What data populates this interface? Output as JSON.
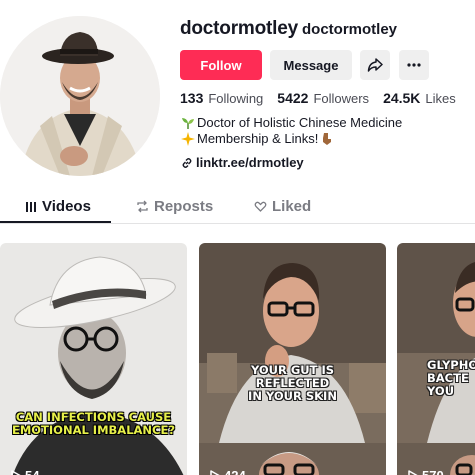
{
  "profile": {
    "username": "doctormotley",
    "nickname": "doctormotley"
  },
  "actions": {
    "follow_label": "Follow",
    "message_label": "Message",
    "share_icon": "share-arrow-icon",
    "more_icon": "more-dots-icon"
  },
  "stats": [
    {
      "value": "133",
      "label": "Following"
    },
    {
      "value": "5422",
      "label": "Followers"
    },
    {
      "value": "24.5K",
      "label": "Likes"
    }
  ],
  "bio": {
    "line1": "Doctor of Holistic Chinese Medicine",
    "line2": "Membership & Links!",
    "link": "linktr.ee/drmotley"
  },
  "tabs": [
    {
      "label": "Videos",
      "icon": "grid-icon",
      "active": true
    },
    {
      "label": "Reposts",
      "icon": "repost-icon",
      "active": false
    },
    {
      "label": "Liked",
      "icon": "heart-outline-icon",
      "active": false
    }
  ],
  "videos": [
    {
      "caption_lines": [
        "CAN INFECTIONS CAUSE",
        "EMOTIONAL IMBALANCE?"
      ],
      "views": "54"
    },
    {
      "caption_lines": [
        "YOUR GUT IS",
        "REFLECTED",
        "IN YOUR SKIN"
      ],
      "views": "424"
    },
    {
      "caption_lines": [
        "GLYPHO",
        "BACTE",
        "YOU"
      ],
      "views": "570"
    }
  ],
  "colors": {
    "follow": "#fe2c55",
    "caption_yellow": "#e7f04a"
  }
}
